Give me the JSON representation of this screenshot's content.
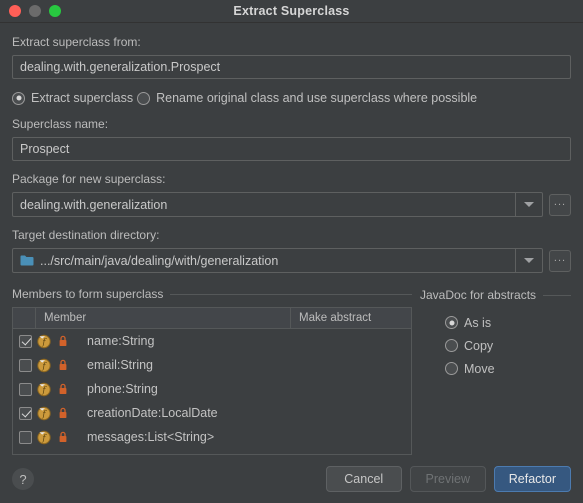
{
  "window": {
    "title": "Extract Superclass",
    "traffic_lights": {
      "close_color": "#ff5f57",
      "minimize_color": "#6b6b6b",
      "maximize_color": "#28c840"
    }
  },
  "theme": {
    "background": "#3c3f41",
    "text": "#bbbbbb",
    "border": "#5e6060",
    "accent": "#365880",
    "field_icon": "#cc9a3c",
    "lock_icon": "#d2622a",
    "folder_icon": "#4a90b8"
  },
  "source": {
    "label": "Extract superclass from:",
    "value": "dealing.with.generalization.Prospect"
  },
  "mode": {
    "options": [
      {
        "label": "Extract superclass",
        "selected": true
      },
      {
        "label": "Rename original class and use superclass where possible",
        "selected": false
      }
    ]
  },
  "superclass_name": {
    "label": "Superclass name:",
    "value": "Prospect"
  },
  "package": {
    "label": "Package for new superclass:",
    "value": "dealing.with.generalization",
    "browse_label": "..."
  },
  "target_directory": {
    "label": "Target destination directory:",
    "value": ".../src/main/java/dealing/with/generalization",
    "icon": "folder-icon",
    "browse_label": "..."
  },
  "members": {
    "group_title": "Members to form superclass",
    "columns": [
      "Member",
      "Make abstract"
    ],
    "rows": [
      {
        "checked": true,
        "icon": "field-icon",
        "visibility_icon": "lock-icon",
        "name": "name:String",
        "abstract": false
      },
      {
        "checked": false,
        "icon": "field-icon",
        "visibility_icon": "lock-icon",
        "name": "email:String",
        "abstract": false
      },
      {
        "checked": false,
        "icon": "field-icon",
        "visibility_icon": "lock-icon",
        "name": "phone:String",
        "abstract": false
      },
      {
        "checked": true,
        "icon": "field-icon",
        "visibility_icon": "lock-icon",
        "name": "creationDate:LocalDate",
        "abstract": false
      },
      {
        "checked": false,
        "icon": "field-icon",
        "visibility_icon": "lock-icon",
        "name": "messages:List<String>",
        "abstract": false
      }
    ]
  },
  "javadoc": {
    "group_title": "JavaDoc for abstracts",
    "options": [
      {
        "label": "As is",
        "selected": true
      },
      {
        "label": "Copy",
        "selected": false
      },
      {
        "label": "Move",
        "selected": false
      }
    ]
  },
  "footer": {
    "help_label": "?",
    "cancel_label": "Cancel",
    "preview_label": "Preview",
    "preview_enabled": false,
    "refactor_label": "Refactor"
  }
}
